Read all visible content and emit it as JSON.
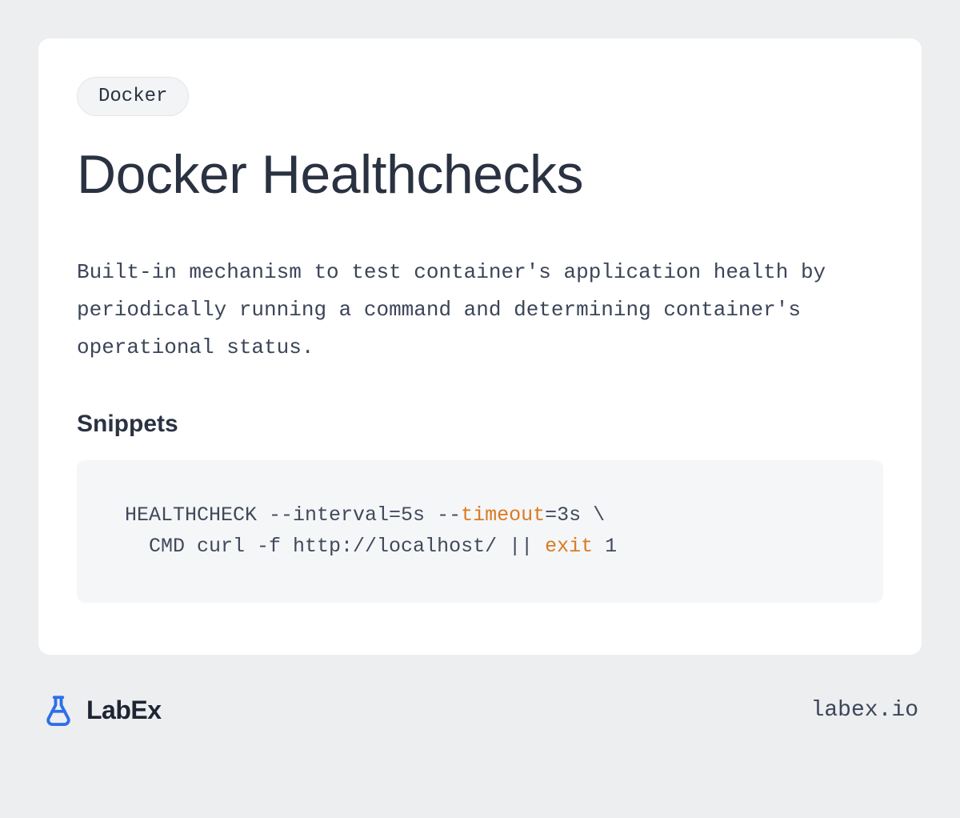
{
  "tag": "Docker",
  "title": "Docker Healthchecks",
  "description": "Built-in mechanism to test container's application health by periodically running a command and determining container's operational status.",
  "snippets_label": "Snippets",
  "code": {
    "l1a": "HEALTHCHECK --interval=5s --",
    "l1_kw": "timeout",
    "l1b": "=3s \\",
    "l2a": "  CMD curl -f http://localhost/ || ",
    "l2_kw": "exit",
    "l2b": " 1"
  },
  "brand": "LabEx",
  "brand_url": "labex.io"
}
